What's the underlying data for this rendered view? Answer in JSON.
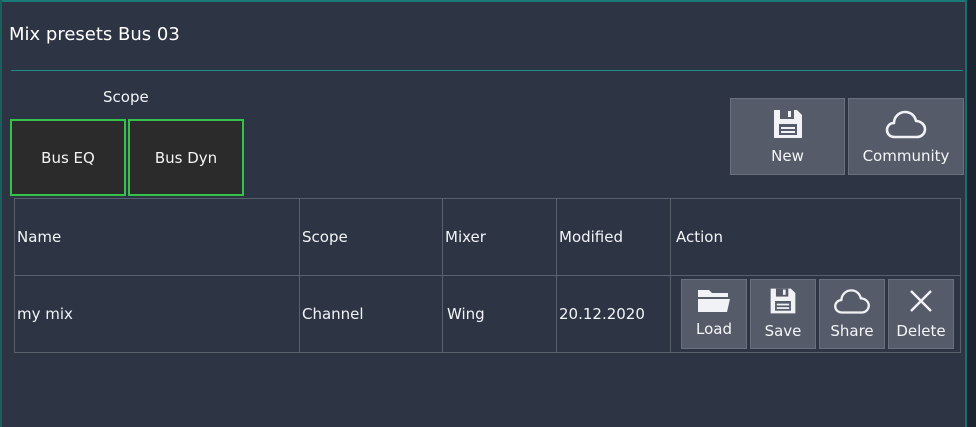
{
  "dialog": {
    "title": "Mix presets Bus 03",
    "scope_label": "Scope",
    "scope_buttons": [
      "Bus EQ",
      "Bus Dyn"
    ],
    "toolbar": {
      "new_label": "New",
      "community_label": "Community"
    }
  },
  "table": {
    "headers": [
      "Name",
      "Scope",
      "Mixer",
      "Modified",
      "Action"
    ],
    "rows": [
      {
        "name": "my mix",
        "scope": "Channel",
        "mixer": "Wing",
        "modified": "20.12.2020",
        "actions": [
          "Load",
          "Save",
          "Share",
          "Delete"
        ]
      }
    ]
  },
  "icons": {
    "new": "floppy-disk-icon",
    "community": "cloud-icon",
    "load": "folder-icon",
    "save": "floppy-disk-icon",
    "share": "cloud-icon",
    "delete": "close-icon"
  },
  "colors": {
    "background": "#2d3443",
    "accent_rule": "#1f8c89",
    "scope_border": "#34c24a",
    "button_bg": "#555b69"
  }
}
